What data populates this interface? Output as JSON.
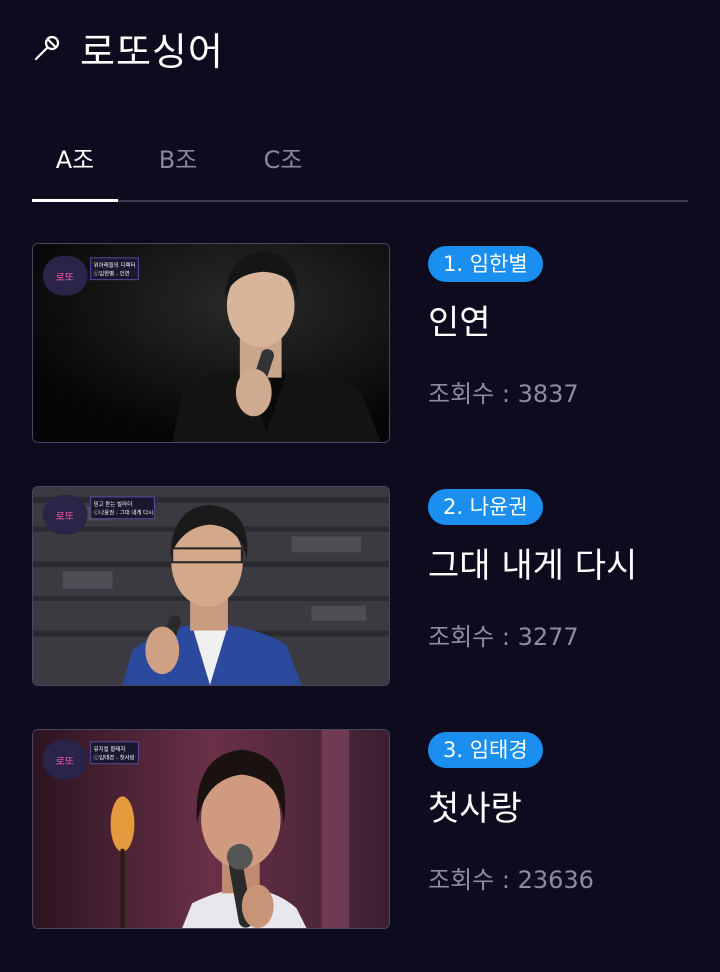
{
  "header": {
    "title": "로또싱어",
    "icon": "microphone-icon"
  },
  "tabs": [
    {
      "label": "A조",
      "active": true
    },
    {
      "label": "B조",
      "active": false
    },
    {
      "label": "C조",
      "active": false
    }
  ],
  "items": [
    {
      "badge": "1. 임한별",
      "song": "인연",
      "views": "조회수 : 3837",
      "caption_top": "위아래들의 디렉터",
      "caption_bottom": "ⓒ임한별 - 인연"
    },
    {
      "badge": "2. 나윤권",
      "song": "그대 내게 다시",
      "views": "조회수 : 3277",
      "caption_top": "믿고 듣는 발라더",
      "caption_bottom": "ⓒ나윤권 - 그대 내게 다시"
    },
    {
      "badge": "3. 임태경",
      "song": "첫사랑",
      "views": "조회수 : 23636",
      "caption_top": "뮤지컬 황태자",
      "caption_bottom": "ⓒ임태경 - 첫사랑"
    }
  ],
  "colors": {
    "background": "#0e0b1f",
    "badge": "#1a8ff0",
    "muted_text": "#8e8c9c",
    "divider": "#3b3854"
  }
}
